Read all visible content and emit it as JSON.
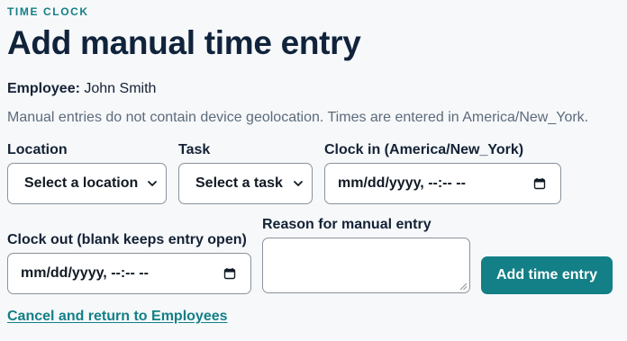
{
  "header": {
    "eyebrow": "TIME CLOCK",
    "title": "Add manual time entry"
  },
  "employee": {
    "label": "Employee:",
    "name": "John Smith"
  },
  "note": "Manual entries do not contain device geolocation. Times are entered in America/New_York.",
  "form": {
    "location": {
      "label": "Location",
      "value": "Select a location"
    },
    "task": {
      "label": "Task",
      "value": "Select a task"
    },
    "clock_in": {
      "label": "Clock in (America/New_York)",
      "value": "mm/dd/yyyy, --:-- --"
    },
    "clock_out": {
      "label": "Clock out (blank keeps entry open)",
      "value": "mm/dd/yyyy, --:-- --"
    },
    "reason": {
      "label": "Reason for manual entry",
      "value": ""
    },
    "submit_label": "Add time entry"
  },
  "cancel_link": "Cancel and return to Employees",
  "colors": {
    "accent": "#137f86",
    "title": "#10233b",
    "muted_text": "#5d6b7b",
    "background": "#f6f8fa"
  },
  "icons": {
    "select_chevron": "chevron-down-icon",
    "date_picker": "calendar-icon"
  }
}
